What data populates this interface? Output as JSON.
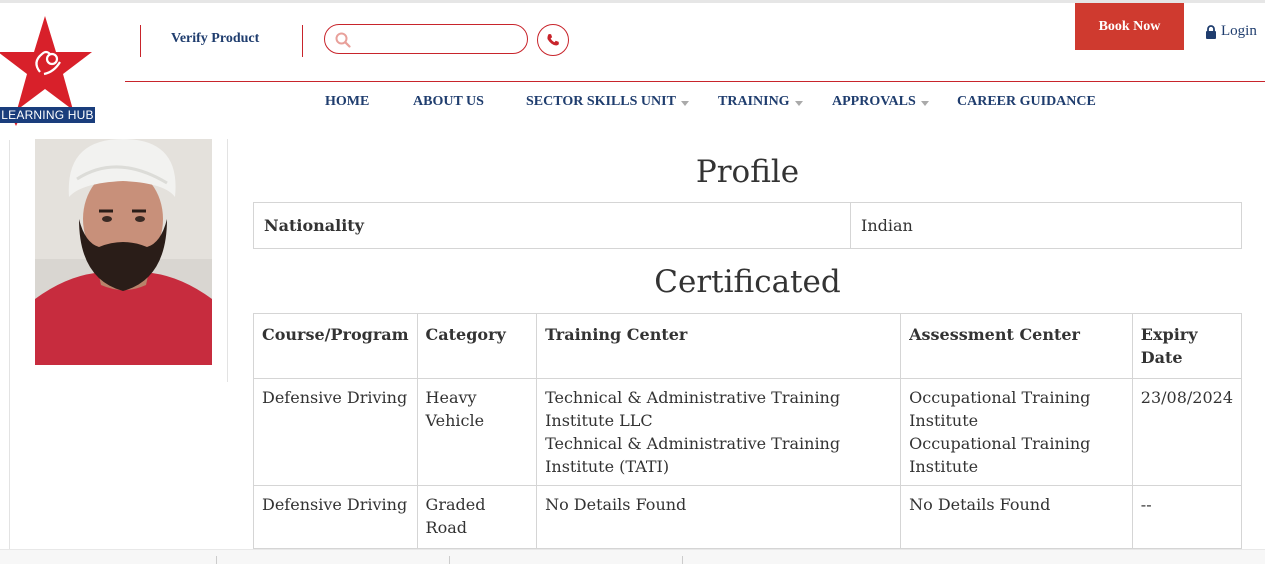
{
  "header": {
    "logo_text": "LEARNING HUB",
    "verify_label": "Verify Product",
    "search_placeholder": "",
    "book_label": "Book Now",
    "login_label": "Login"
  },
  "nav": {
    "items": [
      {
        "label": "HOME",
        "dropdown": false
      },
      {
        "label": "ABOUT US",
        "dropdown": false
      },
      {
        "label": "SECTOR SKILLS UNIT",
        "dropdown": true
      },
      {
        "label": "TRAINING",
        "dropdown": true
      },
      {
        "label": "APPROVALS",
        "dropdown": true
      },
      {
        "label": "CAREER GUIDANCE",
        "dropdown": false
      }
    ]
  },
  "profile": {
    "title": "Profile",
    "rows": [
      {
        "label": "Nationality",
        "value": "Indian"
      }
    ]
  },
  "certificated": {
    "title": "Certificated",
    "columns": [
      "Course/Program",
      "Category",
      "Training Center",
      "Assessment Center",
      "Expiry Date"
    ],
    "rows": [
      {
        "course": "Defensive Driving",
        "category": "Heavy Vehicle",
        "training_center_1": "Technical & Administrative Training Institute LLC",
        "training_center_2": "Technical & Administrative Training Institute (TATI)",
        "assessment_center_1": "Occupational Training Institute",
        "assessment_center_2": "Occupational Training Institute",
        "expiry": "23/08/2024"
      },
      {
        "course": "Defensive Driving",
        "category": "Graded Road",
        "training_center_1": "No Details Found",
        "training_center_2": "",
        "assessment_center_1": "No Details Found",
        "assessment_center_2": "",
        "expiry": "--"
      }
    ]
  },
  "colors": {
    "brand_red": "#c8242b",
    "book_button": "#cf3a2f",
    "nav_blue": "#1f3d6e",
    "logo_blue": "#1a3d7c"
  }
}
